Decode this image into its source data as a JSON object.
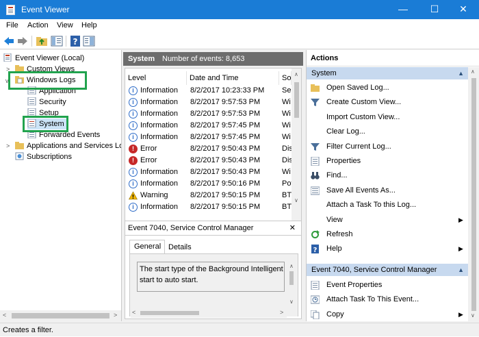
{
  "window": {
    "title": "Event Viewer",
    "minimize": "—",
    "maximize": "☐",
    "close": "✕"
  },
  "menu": [
    "File",
    "Action",
    "View",
    "Help"
  ],
  "tree": {
    "root": "Event Viewer (Local)",
    "custom_views": "Custom Views",
    "windows_logs": "Windows Logs",
    "application": "Application",
    "security": "Security",
    "setup": "Setup",
    "system": "System",
    "forwarded_events": "Forwarded Events",
    "apps_services": "Applications and Services Log",
    "subscriptions": "Subscriptions"
  },
  "events_panel": {
    "log_name": "System",
    "count_text": "Number of events: 8,653",
    "columns": [
      "Level",
      "Date and Time",
      "Sou"
    ],
    "rows": [
      {
        "level": "Information",
        "icon": "information-icon",
        "date": "8/2/2017 10:23:33 PM",
        "source": "Ser"
      },
      {
        "level": "Information",
        "icon": "information-icon",
        "date": "8/2/2017 9:57:53 PM",
        "source": "Wi"
      },
      {
        "level": "Information",
        "icon": "information-icon",
        "date": "8/2/2017 9:57:53 PM",
        "source": "Wi"
      },
      {
        "level": "Information",
        "icon": "information-icon",
        "date": "8/2/2017 9:57:45 PM",
        "source": "Wi"
      },
      {
        "level": "Information",
        "icon": "information-icon",
        "date": "8/2/2017 9:57:45 PM",
        "source": "Wi"
      },
      {
        "level": "Error",
        "icon": "error-icon",
        "date": "8/2/2017 9:50:43 PM",
        "source": "Dis"
      },
      {
        "level": "Error",
        "icon": "error-icon",
        "date": "8/2/2017 9:50:43 PM",
        "source": "Dis"
      },
      {
        "level": "Information",
        "icon": "information-icon",
        "date": "8/2/2017 9:50:43 PM",
        "source": "Wi"
      },
      {
        "level": "Information",
        "icon": "information-icon",
        "date": "8/2/2017 9:50:16 PM",
        "source": "Pov"
      },
      {
        "level": "Warning",
        "icon": "warning-icon",
        "date": "8/2/2017 9:50:15 PM",
        "source": "BTH"
      },
      {
        "level": "Information",
        "icon": "information-icon",
        "date": "8/2/2017 9:50:15 PM",
        "source": "BTH"
      }
    ]
  },
  "detail": {
    "title": "Event 7040, Service Control Manager",
    "close": "✕",
    "tabs": [
      "General",
      "Details"
    ],
    "line1": "The start type of the Background Intelligent T",
    "line2": "start to auto start."
  },
  "actions": {
    "header": "Actions",
    "section1": "System",
    "items1": [
      {
        "label": "Open Saved Log...",
        "icon": "open-folder-icon"
      },
      {
        "label": "Create Custom View...",
        "icon": "filter-icon"
      },
      {
        "label": "Import Custom View...",
        "icon": ""
      },
      {
        "label": "Clear Log...",
        "icon": ""
      },
      {
        "label": "Filter Current Log...",
        "icon": "filter-icon"
      },
      {
        "label": "Properties",
        "icon": "properties-icon"
      },
      {
        "label": "Find...",
        "icon": "binoculars-icon"
      },
      {
        "label": "Save All Events As...",
        "icon": "save-icon"
      },
      {
        "label": "Attach a Task To this Log...",
        "icon": ""
      },
      {
        "label": "View",
        "icon": ""
      },
      {
        "label": "Refresh",
        "icon": "refresh-icon"
      },
      {
        "label": "Help",
        "icon": "help-icon"
      }
    ],
    "section2": "Event 7040, Service Control Manager",
    "items2": [
      {
        "label": "Event Properties",
        "icon": "properties-icon"
      },
      {
        "label": "Attach Task To This Event...",
        "icon": "task-icon"
      },
      {
        "label": "Copy",
        "icon": "copy-icon"
      }
    ]
  },
  "status": "Creates a filter."
}
